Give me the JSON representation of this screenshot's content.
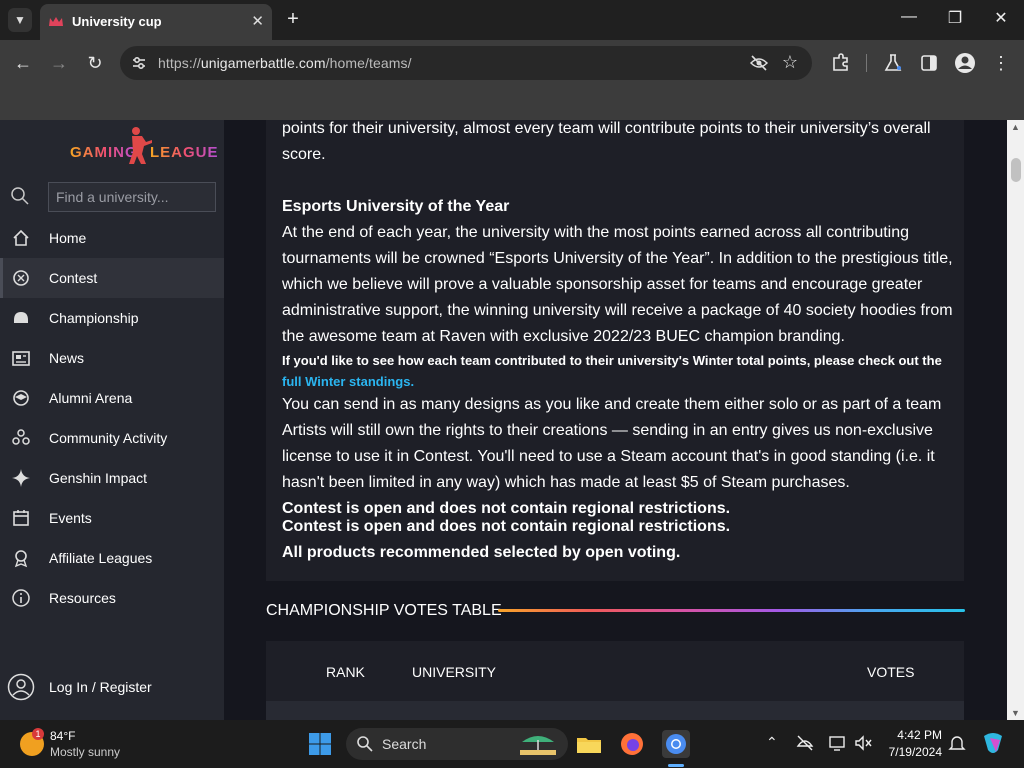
{
  "browser": {
    "tab_title": "University cup",
    "url_prefix": "https://",
    "url_host": "unigamerbattle.com",
    "url_path": "/home/teams/"
  },
  "sidebar": {
    "logo_text_left": "GAMING",
    "logo_text_right": "LEAGUE",
    "search_placeholder": "Find a university...",
    "items": [
      {
        "label": "Home"
      },
      {
        "label": "Contest"
      },
      {
        "label": "Championship"
      },
      {
        "label": "News"
      },
      {
        "label": "Alumni Arena"
      },
      {
        "label": "Community Activity"
      },
      {
        "label": "Genshin Impact"
      },
      {
        "label": "Events"
      },
      {
        "label": "Affiliate Leagues"
      },
      {
        "label": "Resources"
      }
    ],
    "login_label": "Log In / Register"
  },
  "content": {
    "intro": "points for their university, almost every team will contribute points to their university’s overall score.",
    "heading": "Esports University of the Year",
    "body": "At the end of each year, the university with the most points earned across all contributing tournaments will be crowned “Esports University of the Year”. In addition to the prestigious title, which we believe will prove a valuable sponsorship asset for teams and encourage greater administrative support, the winning university will receive a package of 40 society hoodies from the awesome team at Raven with exclusive 2022/23 BUEC champion branding.",
    "standings_text": "If you'd like to see how each team contributed to their university's Winter total points, please check out the",
    "standings_link": "full Winter standings.",
    "designs": "You can send in as many designs as you like and create them either solo or as part of a team Artists will still own the rights to their creations — sending in an entry gives us non-exclusive license to use it in Contest. You'll need to use a Steam account that's in good standing (i.e. it hasn't been limited in any way) which has made at least $5 of Steam purchases.",
    "rule_1": "Contest is open and does not contain regional restrictions.",
    "rule_2": "Contest is open and does not contain regional restrictions.",
    "rule_3": "All products recommended selected by open voting."
  },
  "votes_table": {
    "title": "CHAMPIONSHIP VOTES TABLE",
    "col_rank": "RANK",
    "col_university": "UNIVERSITY",
    "col_votes": "VOTES"
  },
  "taskbar": {
    "weather_temp": "84°F",
    "weather_desc": "Mostly sunny",
    "weather_badge": "1",
    "search_label": "Search",
    "time": "4:42 PM",
    "date": "7/19/2024"
  }
}
